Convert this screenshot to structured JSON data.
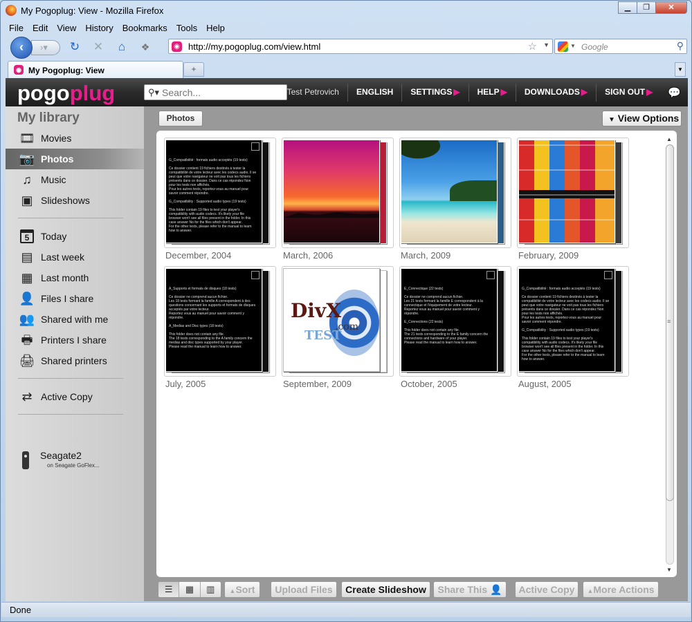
{
  "window": {
    "title": "My Pogoplug: View - Mozilla Firefox",
    "minimize": "▁",
    "restore": "❐",
    "close": "✕"
  },
  "menubar": [
    "File",
    "Edit",
    "View",
    "History",
    "Bookmarks",
    "Tools",
    "Help"
  ],
  "navbar": {
    "url": "http://my.pogoplug.com/view.html",
    "search_placeholder": "Google"
  },
  "tab": {
    "title": "My Pogoplug: View",
    "newtab": "+"
  },
  "header": {
    "logo_a": "pogo",
    "logo_b": "plug",
    "search_placeholder": "Search...",
    "user": "Test Petrovich",
    "nav": [
      {
        "label": "ENGLISH",
        "arrow": ""
      },
      {
        "label": "SETTINGS",
        "arrow": "▶"
      },
      {
        "label": "HELP",
        "arrow": "▶"
      },
      {
        "label": "DOWNLOADS",
        "arrow": "▶"
      },
      {
        "label": "SIGN OUT",
        "arrow": "▶"
      }
    ]
  },
  "sidebar": {
    "title": "My library",
    "items": [
      {
        "label": "Movies",
        "icon": "movie-icon"
      },
      {
        "label": "Photos",
        "icon": "camera-icon"
      },
      {
        "label": "Music",
        "icon": "music-note-icon"
      },
      {
        "label": "Slideshows",
        "icon": "slideshow-icon"
      },
      {
        "label": "Today",
        "icon": "calendar-day-icon",
        "badge": "5"
      },
      {
        "label": "Last week",
        "icon": "calendar-week-icon"
      },
      {
        "label": "Last month",
        "icon": "calendar-month-icon"
      },
      {
        "label": "Files I share",
        "icon": "user-share-icon"
      },
      {
        "label": "Shared with me",
        "icon": "users-icon"
      },
      {
        "label": "Printers I share",
        "icon": "printer-share-icon"
      },
      {
        "label": "Shared printers",
        "icon": "printer-icon"
      },
      {
        "label": "Active Copy",
        "icon": "copy-arrows-icon"
      }
    ],
    "device": {
      "name": "Seagate2",
      "sub": "on Seagate GoFlex..."
    }
  },
  "main": {
    "breadcrumb": "Photos",
    "view_options": "View Options",
    "albums": [
      {
        "caption": "December, 2004",
        "kind": "text",
        "text": "G_Compatibilité : formats audio acceptés (19 tests)\n\nCe dossier contient 19 fichiers destinés à tester la compatibilité de votre lecteur avec les codecs audio. Il se peut que votre navigateur ne voit pas tous les fichiers présents dans ce dossier. Dans ce cas répondez Non pour les tests non affichés.\nPour les autres tests, reportez-vous au manuel pour savoir comment répondre.\n\nG_Compatibility : Supported audio types (19 tests)\n\nThis folder contain 19 files to test your player's compatibility with audio codecs. It's likely your file browser won't see all files present in the folder. In this case answer No for the files which don't appear.\nFor the other tests, please refer to the manual to learn how to answer."
      },
      {
        "caption": "March, 2006",
        "kind": "sunset",
        "text": ""
      },
      {
        "caption": "March, 2009",
        "kind": "beach",
        "text": ""
      },
      {
        "caption": "February, 2009",
        "kind": "collage",
        "text": ""
      },
      {
        "caption": "July, 2005",
        "kind": "text",
        "text": "A_Supports et formats de disques (18 tests)\n\nCe dossier ne comprend aucun fichier.\nLes 18 tests formant la famille A correspondent à des questions concernant les supports et formats de disques acceptés par votre lecteur.\nReportez vous au manuel pour savoir comment y répondre.\n\nA_Medias and Disc types (18 tests)\n\nThis folder does not contain any file.\nThe 18 tests corresponding to the A family concern the medias and disc types supported by your player.\nPlease read the manual to learn how to answer."
      },
      {
        "caption": "September, 2009",
        "kind": "divx",
        "text": "DivX",
        "text2": "TEST",
        "text3": ".com"
      },
      {
        "caption": "October, 2005",
        "kind": "text",
        "text": "E_Connectique (22 tests)\n\nCe dossier ne comprend aucun fichier.\nLes 21 tests formant la famille E correspondent à la connectique et l'équipement de votre lecteur.\nReportez vous au manuel pour savoir comment y répondre.\n\nE_Connections (22 tests)\n\nThis folder does not contain any file.\nThe 21 tests corresponding to the E family concern the connections and hardware of your player.\nPlease read the manual to learn how to answer."
      },
      {
        "caption": "August, 2005",
        "kind": "text",
        "text": "G_Compatibilité : formats audio acceptés (19 tests)\n\nCe dossier contient 19 fichiers destinés à tester la compatibilité de votre lecteur avec les codecs audio. Il se peut que votre navigateur ne voit pas tous les fichiers présents dans ce dossier. Dans ce cas répondez Non pour les tests non affichés.\nPour les autres tests, reportez-vous au manuel pour savoir comment répondre.\n\nG_Compatibility : Supported audio types (19 tests)\n\nThis folder contain 19 files to test your player's compatibility with audio codecs. It's likely your file browser won't see all files present in the folder. In this case answer No for the files which don't appear.\nFor the other tests, please refer to the manual to learn how to answer."
      }
    ],
    "toolbar": {
      "sort": "Sort",
      "upload": "Upload Files",
      "create_slideshow": "Create Slideshow",
      "share": "Share This",
      "active_copy": "Active Copy",
      "more_actions": "More Actions"
    }
  },
  "status": "Done",
  "colors": {
    "brand": "#e71d8c",
    "header": "#2b2b2b"
  }
}
